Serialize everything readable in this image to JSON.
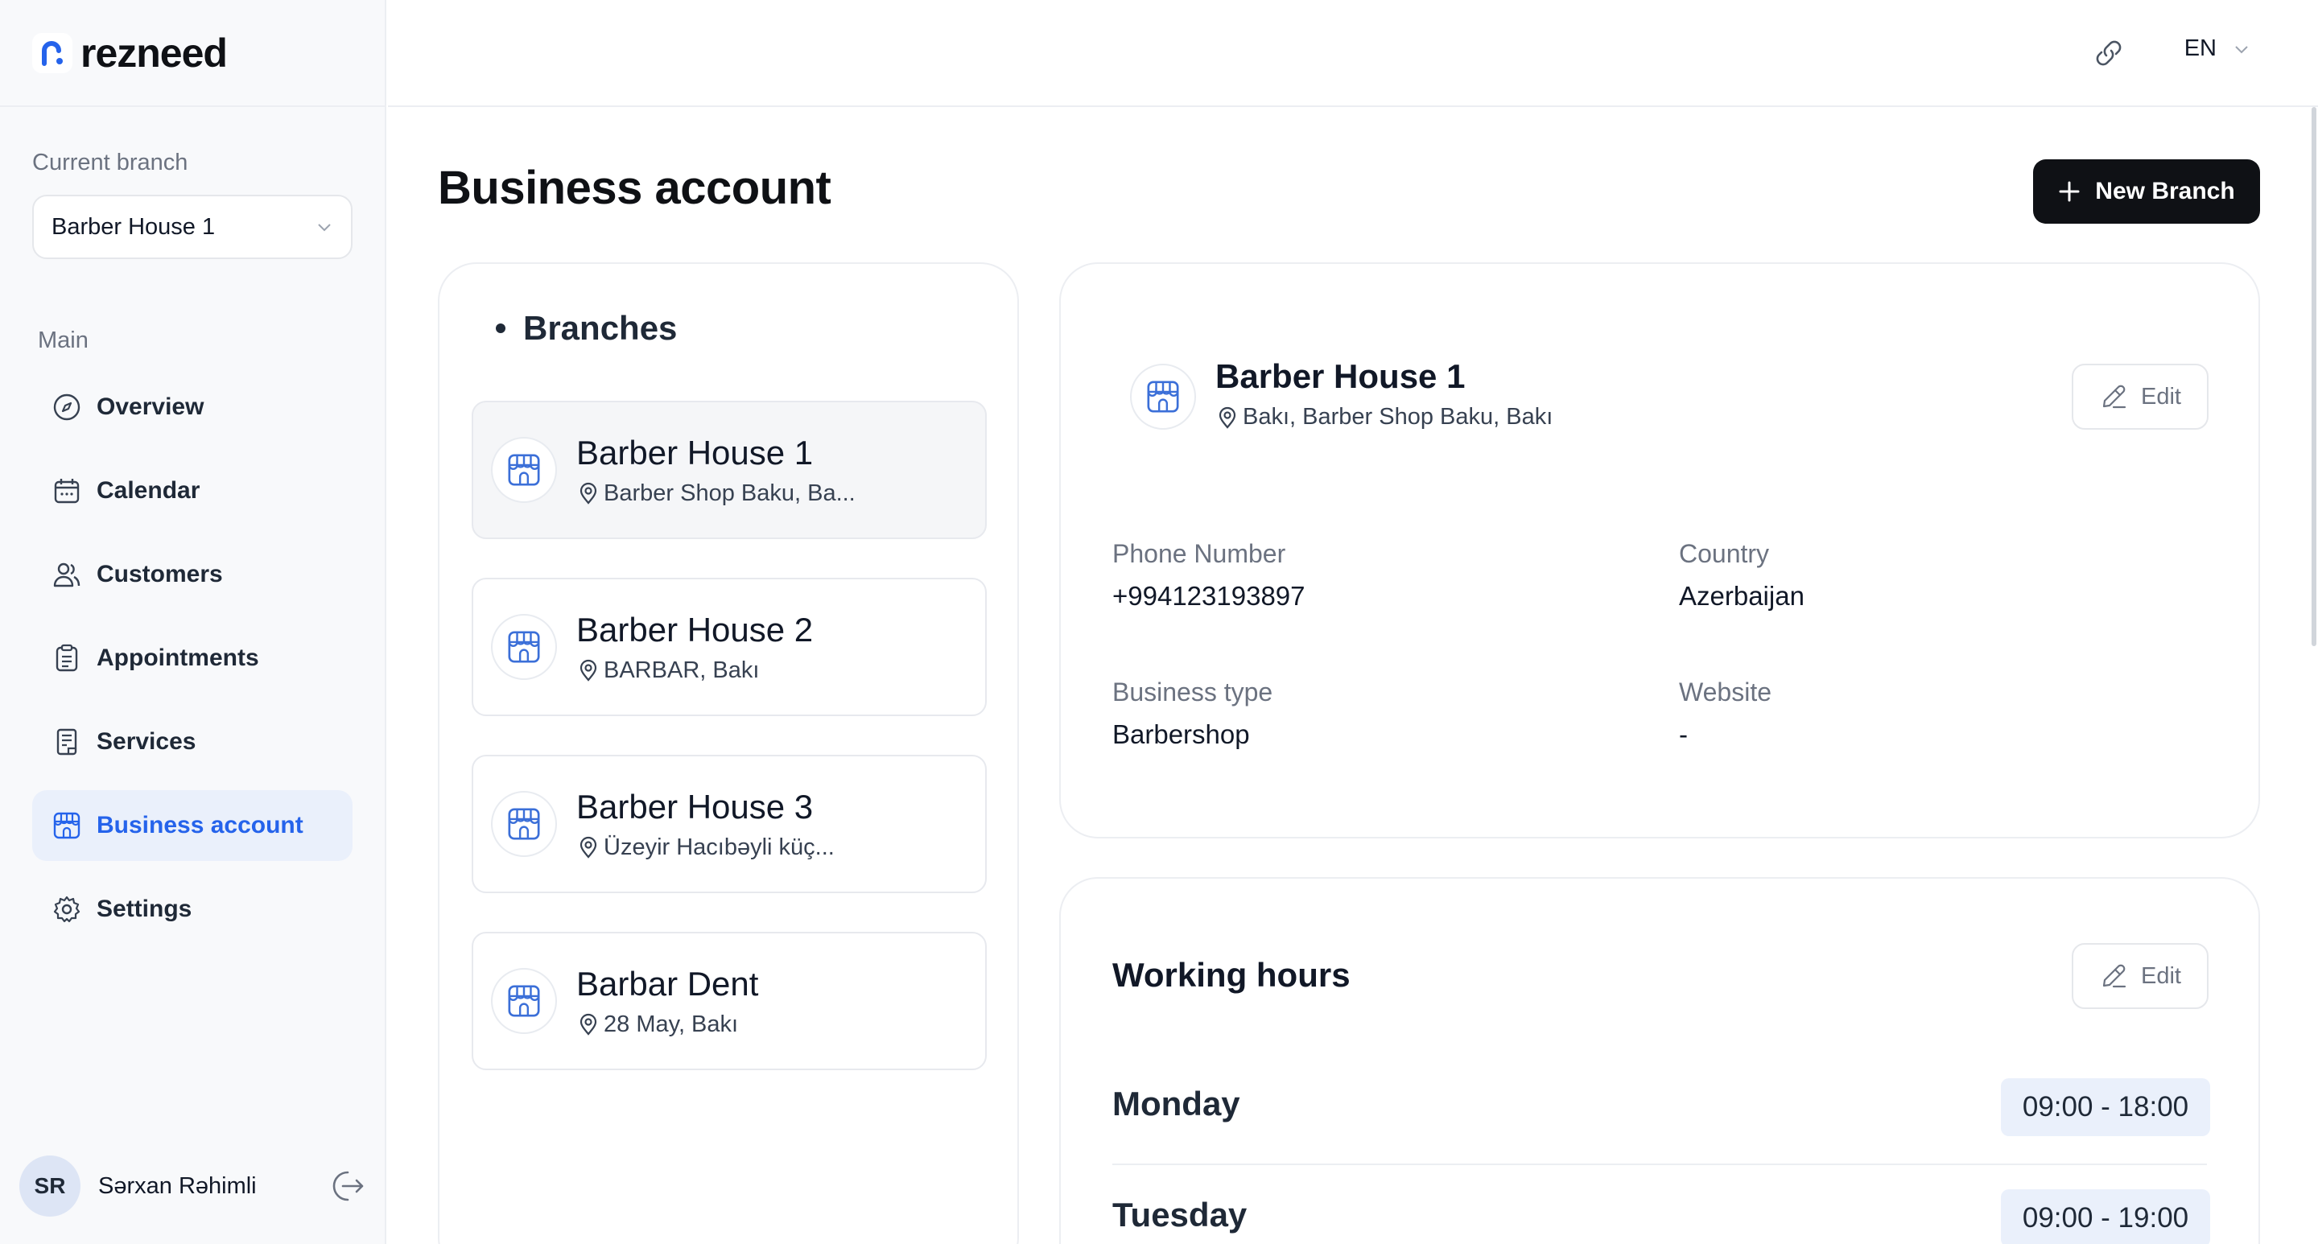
{
  "app": {
    "brand": "rezneed"
  },
  "sidebar": {
    "current_branch_label": "Current branch",
    "current_branch_value": "Barber House 1",
    "section_label": "Main",
    "items": [
      {
        "label": "Overview",
        "icon": "compass-icon"
      },
      {
        "label": "Calendar",
        "icon": "calendar-icon"
      },
      {
        "label": "Customers",
        "icon": "users-icon"
      },
      {
        "label": "Appointments",
        "icon": "clipboard-icon"
      },
      {
        "label": "Services",
        "icon": "document-icon"
      },
      {
        "label": "Business account",
        "icon": "store-icon",
        "active": true
      },
      {
        "label": "Settings",
        "icon": "gear-icon"
      }
    ],
    "user": {
      "initials": "SR",
      "name": "Sərxan Rəhimli"
    }
  },
  "header": {
    "language": "EN"
  },
  "main": {
    "title": "Business account",
    "new_branch_label": "New Branch",
    "branches_title": "Branches",
    "branches": [
      {
        "name": "Barber House 1",
        "address": "Barber Shop Baku, Ba...",
        "selected": true
      },
      {
        "name": "Barber House 2",
        "address": "BARBAR, Bakı"
      },
      {
        "name": "Barber House 3",
        "address": "Üzeyir Hacıbəyli küç..."
      },
      {
        "name": "Barbar Dent",
        "address": "28 May, Bakı"
      }
    ],
    "detail": {
      "name": "Barber House 1",
      "address": "Bakı, Barber Shop Baku, Bakı",
      "edit_label": "Edit",
      "phone_label": "Phone Number",
      "phone_value": "+994123193897",
      "country_label": "Country",
      "country_value": "Azerbaijan",
      "business_type_label": "Business type",
      "business_type_value": "Barbershop",
      "website_label": "Website",
      "website_value": "-"
    },
    "working_hours": {
      "title": "Working hours",
      "edit_label": "Edit",
      "days": [
        {
          "day": "Monday",
          "hours": "09:00 - 18:00"
        },
        {
          "day": "Tuesday",
          "hours": "09:00 - 19:00"
        }
      ]
    }
  },
  "colors": {
    "accent": "#2563eb",
    "active_bg": "#eaf0fb",
    "primary_button": "#0f1115"
  }
}
